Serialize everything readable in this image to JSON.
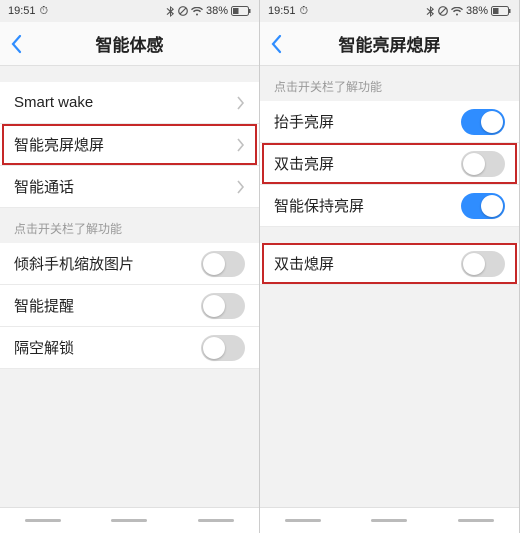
{
  "status": {
    "time": "19:51",
    "battery_pct": "38%"
  },
  "left": {
    "title": "智能体感",
    "rows_nav": [
      {
        "label": "Smart wake"
      },
      {
        "label": "智能亮屏熄屏",
        "highlight": true
      },
      {
        "label": "智能通话"
      }
    ],
    "section_header": "点击开关栏了解功能",
    "rows_toggle": [
      {
        "label": "倾斜手机缩放图片",
        "on": false
      },
      {
        "label": "智能提醒",
        "on": false
      },
      {
        "label": "隔空解锁",
        "on": false
      }
    ]
  },
  "right": {
    "title": "智能亮屏熄屏",
    "section_header": "点击开关栏了解功能",
    "rows_toggle_a": [
      {
        "label": "抬手亮屏",
        "on": true
      },
      {
        "label": "双击亮屏",
        "on": false,
        "highlight": true
      },
      {
        "label": "智能保持亮屏",
        "on": true
      }
    ],
    "rows_toggle_b": [
      {
        "label": "双击熄屏",
        "on": false,
        "highlight": true
      }
    ]
  }
}
